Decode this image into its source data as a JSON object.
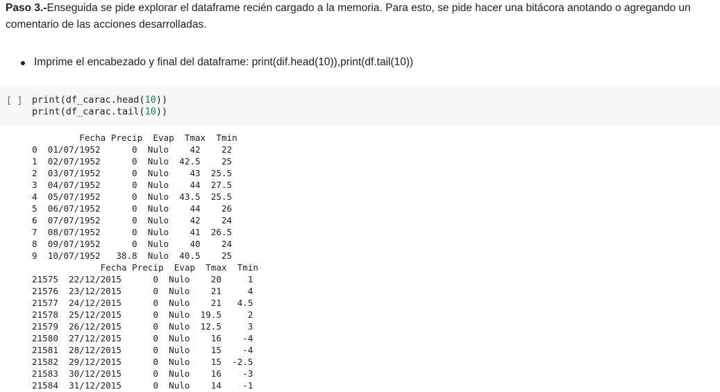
{
  "markdown": {
    "step_label": "Paso 3.-",
    "step_text": "Enseguida se pide explorar el dataframe recién cargado a la memoria. Para esto, se pide hacer una bitácora anotando o agregando un comentario de las acciones desarrolladas.",
    "bullet": "Imprime el encabezado y final del dataframe: print(dif.head(10)),print(df.tail(10))"
  },
  "cell": {
    "run_label": "[ ]",
    "code_line1_pre": "print(df_carac.head(",
    "code_line1_num": "10",
    "code_line1_post": "))",
    "code_line2_pre": "print(df_carac.tail(",
    "code_line2_num": "10",
    "code_line2_post": "))"
  },
  "output": {
    "head_header": "         Fecha Precip  Evap  Tmax  Tmin",
    "head_rows": [
      "0  01/07/1952      0  Nulo    42    22",
      "1  02/07/1952      0  Nulo  42.5    25",
      "2  03/07/1952      0  Nulo    43  25.5",
      "3  04/07/1952      0  Nulo    44  27.5",
      "4  05/07/1952      0  Nulo  43.5  25.5",
      "5  06/07/1952      0  Nulo    44    26",
      "6  07/07/1952      0  Nulo    42    24",
      "7  08/07/1952      0  Nulo    41  26.5",
      "8  09/07/1952      0  Nulo    40    24",
      "9  10/07/1952   38.8  Nulo  40.5    25"
    ],
    "tail_header": "             Fecha Precip  Evap  Tmax  Tmin",
    "tail_rows": [
      "21575  22/12/2015      0  Nulo    20     1",
      "21576  23/12/2015      0  Nulo    21     4",
      "21577  24/12/2015      0  Nulo    21   4.5",
      "21578  25/12/2015      0  Nulo  19.5     2",
      "21579  26/12/2015      0  Nulo  12.5     3",
      "21580  27/12/2015      0  Nulo    16    -4",
      "21581  28/12/2015      0  Nulo    15    -4",
      "21582  29/12/2015      0  Nulo    15  -2.5",
      "21583  30/12/2015      0  Nulo    16    -3",
      "21584  31/12/2015      0  Nulo    14    -1"
    ]
  }
}
